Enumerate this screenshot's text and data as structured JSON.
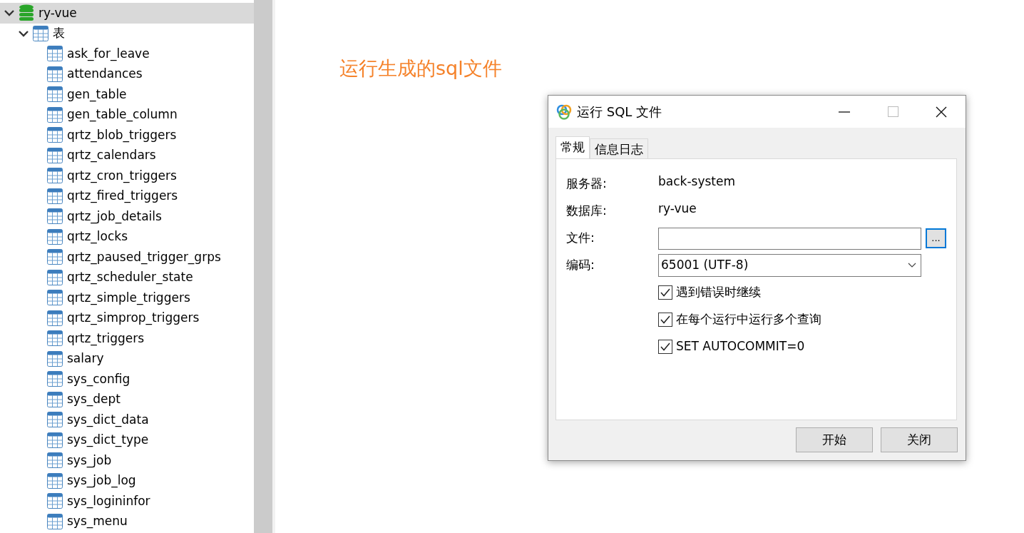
{
  "tree": {
    "label": "ry-vue",
    "expanded": true,
    "selected": true,
    "children": [
      {
        "label": "表",
        "expanded": true,
        "selected": false,
        "children": [
          {
            "label": "ask_for_leave"
          },
          {
            "label": "attendances"
          },
          {
            "label": "gen_table"
          },
          {
            "label": "gen_table_column"
          },
          {
            "label": "qrtz_blob_triggers"
          },
          {
            "label": "qrtz_calendars"
          },
          {
            "label": "qrtz_cron_triggers"
          },
          {
            "label": "qrtz_fired_triggers"
          },
          {
            "label": "qrtz_job_details"
          },
          {
            "label": "qrtz_locks"
          },
          {
            "label": "qrtz_paused_trigger_grps"
          },
          {
            "label": "qrtz_scheduler_state"
          },
          {
            "label": "qrtz_simple_triggers"
          },
          {
            "label": "qrtz_simprop_triggers"
          },
          {
            "label": "qrtz_triggers"
          },
          {
            "label": "salary"
          },
          {
            "label": "sys_config"
          },
          {
            "label": "sys_dept"
          },
          {
            "label": "sys_dict_data"
          },
          {
            "label": "sys_dict_type"
          },
          {
            "label": "sys_job"
          },
          {
            "label": "sys_job_log"
          },
          {
            "label": "sys_logininfor"
          },
          {
            "label": "sys_menu"
          }
        ]
      }
    ]
  },
  "annotation": "运行生成的sql文件",
  "dialog": {
    "title": "运行 SQL 文件",
    "tabs": [
      {
        "label": "常规",
        "selected": true
      },
      {
        "label": "信息日志",
        "selected": false
      }
    ],
    "fields": [
      {
        "kind": "text",
        "label": "服务器:",
        "value": "back-system"
      },
      {
        "kind": "text",
        "label": "数据库:",
        "value": "ry-vue"
      },
      {
        "kind": "file",
        "label": "文件:",
        "button": "..."
      },
      {
        "kind": "select",
        "label": "编码:",
        "value": "65001 (UTF-8)"
      }
    ],
    "options": [
      {
        "label": "遇到错误时继续",
        "checked": true
      },
      {
        "label": "在每个运行中运行多个查询",
        "checked": true
      },
      {
        "label": "SET AUTOCOMMIT=0",
        "checked": true
      }
    ],
    "buttons": [
      "开始",
      "关闭"
    ]
  }
}
